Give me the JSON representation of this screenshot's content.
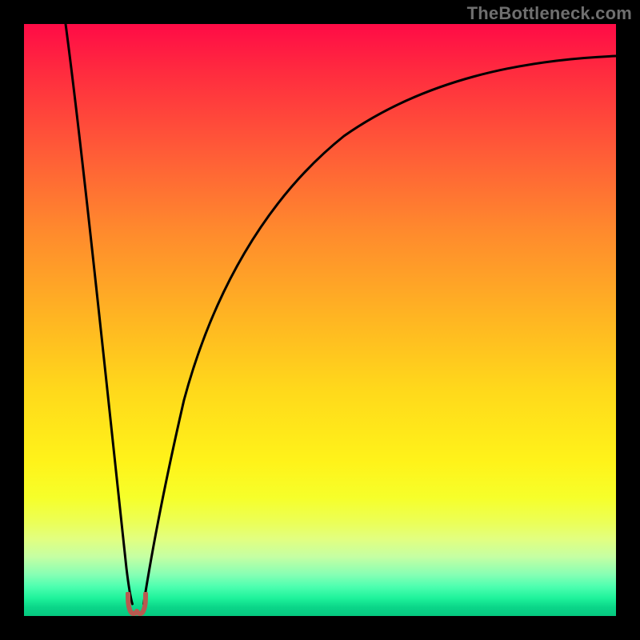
{
  "watermark": "TheBottleneck.com",
  "colors": {
    "frame": "#000000",
    "watermark": "#6f6f6f",
    "curve": "#000000",
    "notch_fill": "#b85a50",
    "gradient_stops": [
      "#ff0b46",
      "#ff2b3f",
      "#ff5d37",
      "#ff8a2d",
      "#ffb622",
      "#ffd91b",
      "#fff31a",
      "#f6ff2a",
      "#ecff55",
      "#e2ff80",
      "#c5ffa3",
      "#86ffb4",
      "#4effb0",
      "#1ef29b",
      "#0bd689",
      "#05c87f"
    ]
  },
  "chart_data": {
    "type": "line",
    "title": "",
    "xlabel": "",
    "ylabel": "",
    "xlim": [
      0,
      100
    ],
    "ylim": [
      0,
      100
    ],
    "grid": false,
    "series": [
      {
        "name": "left-branch",
        "x": [
          7,
          8,
          9,
          10,
          11,
          12,
          13,
          14,
          15,
          16,
          17,
          18,
          18.3
        ],
        "y": [
          100,
          90,
          80,
          71,
          62,
          53,
          44,
          36,
          28,
          20,
          12,
          5,
          2
        ]
      },
      {
        "name": "right-branch",
        "x": [
          20.2,
          21,
          22,
          23,
          25,
          27,
          30,
          34,
          38,
          43,
          49,
          55,
          62,
          70,
          78,
          86,
          94,
          100
        ],
        "y": [
          2,
          6,
          12,
          18,
          28,
          37,
          47,
          56,
          63,
          70,
          76,
          80,
          84,
          87.5,
          90,
          92,
          93.5,
          94.5
        ]
      }
    ],
    "annotations": [
      {
        "name": "notch",
        "x": 19.2,
        "y": 1.5,
        "shape": "u",
        "color": "#b85a50"
      }
    ]
  }
}
